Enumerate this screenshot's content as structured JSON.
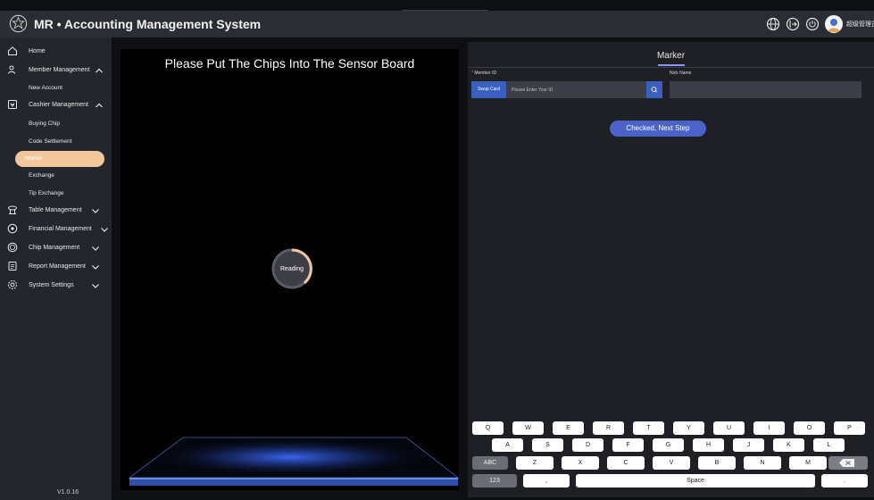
{
  "app": {
    "title": "MR • Accounting Management System",
    "user_name": "超级管理员",
    "version": "V1.0.16"
  },
  "sidebar": {
    "items": [
      {
        "label": "Home",
        "icon": "home-icon"
      },
      {
        "label": "Member Management",
        "icon": "members-icon"
      },
      {
        "label": "New Account"
      },
      {
        "label": "Cashier Management",
        "icon": "cashier-icon"
      },
      {
        "label": "Buying Chip"
      },
      {
        "label": "Code Settlement"
      },
      {
        "label": "Marker"
      },
      {
        "label": "Exchange"
      },
      {
        "label": "Tip Exchange"
      },
      {
        "label": "Table Management",
        "icon": "table-icon"
      },
      {
        "label": "Financial Management",
        "icon": "finance-icon"
      },
      {
        "label": "Chip Management",
        "icon": "chip-icon"
      },
      {
        "label": "Report Management",
        "icon": "report-icon"
      },
      {
        "label": "System Settings",
        "icon": "settings-icon"
      }
    ]
  },
  "sensor": {
    "title": "Please Put The Chips Into The Sensor Board",
    "status": "Reading"
  },
  "form": {
    "tab": "Marker",
    "member_id_label": "Member ID",
    "required_mark": "*",
    "nick_name_label": "Nick Name",
    "swap_card": "Swap Card",
    "id_placeholder": "Please Enter Your ID",
    "next_step": "Checked, Next Step"
  },
  "keyboard": {
    "row1": [
      "Q",
      "W",
      "E",
      "R",
      "T",
      "Y",
      "U",
      "I",
      "O",
      "P"
    ],
    "row2": [
      "A",
      "S",
      "D",
      "F",
      "G",
      "H",
      "J",
      "K",
      "L"
    ],
    "row3": [
      "ABC",
      "Z",
      "X",
      "C",
      "V",
      "B",
      "N",
      "M"
    ],
    "row4": [
      "123",
      ",",
      "Space",
      "."
    ]
  },
  "colors": {
    "accent": "#3a5fbf",
    "active_nav": "#f3c79b",
    "reading_ring": "#f3c79b"
  }
}
